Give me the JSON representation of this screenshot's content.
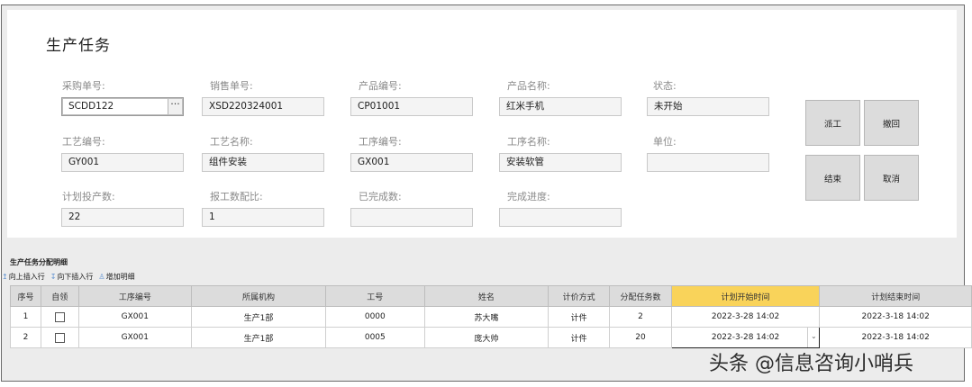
{
  "form": {
    "title": "生产任务",
    "fields": [
      {
        "label": "采购单号:",
        "value": "SCDD122",
        "browse": "···"
      },
      {
        "label": "销售单号:",
        "value": "XSD220324001"
      },
      {
        "label": "产品编号:",
        "value": "CP01001"
      },
      {
        "label": "产品名称:",
        "value": "红米手机"
      },
      {
        "label": "状态:",
        "value": "未开始"
      },
      {
        "label": "工艺编号:",
        "value": "GY001"
      },
      {
        "label": "工艺名称:",
        "value": "组件安装"
      },
      {
        "label": "工序编号:",
        "value": "GX001"
      },
      {
        "label": "工序名称:",
        "value": "安装软管"
      },
      {
        "label": "单位:",
        "value": ""
      },
      {
        "label": "计划投产数:",
        "value": "22"
      },
      {
        "label": "报工数配比:",
        "value": "1"
      },
      {
        "label": "已完成数:",
        "value": ""
      },
      {
        "label": "完成进度:",
        "value": ""
      }
    ],
    "buttons": {
      "dispatch": "派工",
      "revoke": "撤回",
      "finish": "结束",
      "cancel": "取消"
    }
  },
  "detail": {
    "title": "生产任务分配明细",
    "toolbar": {
      "insert_above": "向上插入行",
      "insert_below": "向下插入行",
      "add_detail": "增加明细"
    },
    "columns": [
      "序号",
      "自领",
      "工序编号",
      "所属机构",
      "工号",
      "姓名",
      "计价方式",
      "分配任务数",
      "计划开始时间",
      "计划结束时间"
    ],
    "rows": [
      {
        "no": "1",
        "self_claim": false,
        "process": "GX001",
        "org": "生产1部",
        "emp_id": "0000",
        "name": "苏大嘴",
        "pricing": "计件",
        "qty": "2",
        "start": "2022-3-28 14:02",
        "end": "2022-3-18 14:02"
      },
      {
        "no": "2",
        "self_claim": false,
        "process": "GX001",
        "org": "生产1部",
        "emp_id": "0005",
        "name": "庞大帅",
        "pricing": "计件",
        "qty": "20",
        "start": "2022-3-28 14:02",
        "end": "2022-3-18 14:02"
      }
    ],
    "highlight_color": "#f9d35a"
  },
  "watermark": "头条 @信息咨询小哨兵"
}
